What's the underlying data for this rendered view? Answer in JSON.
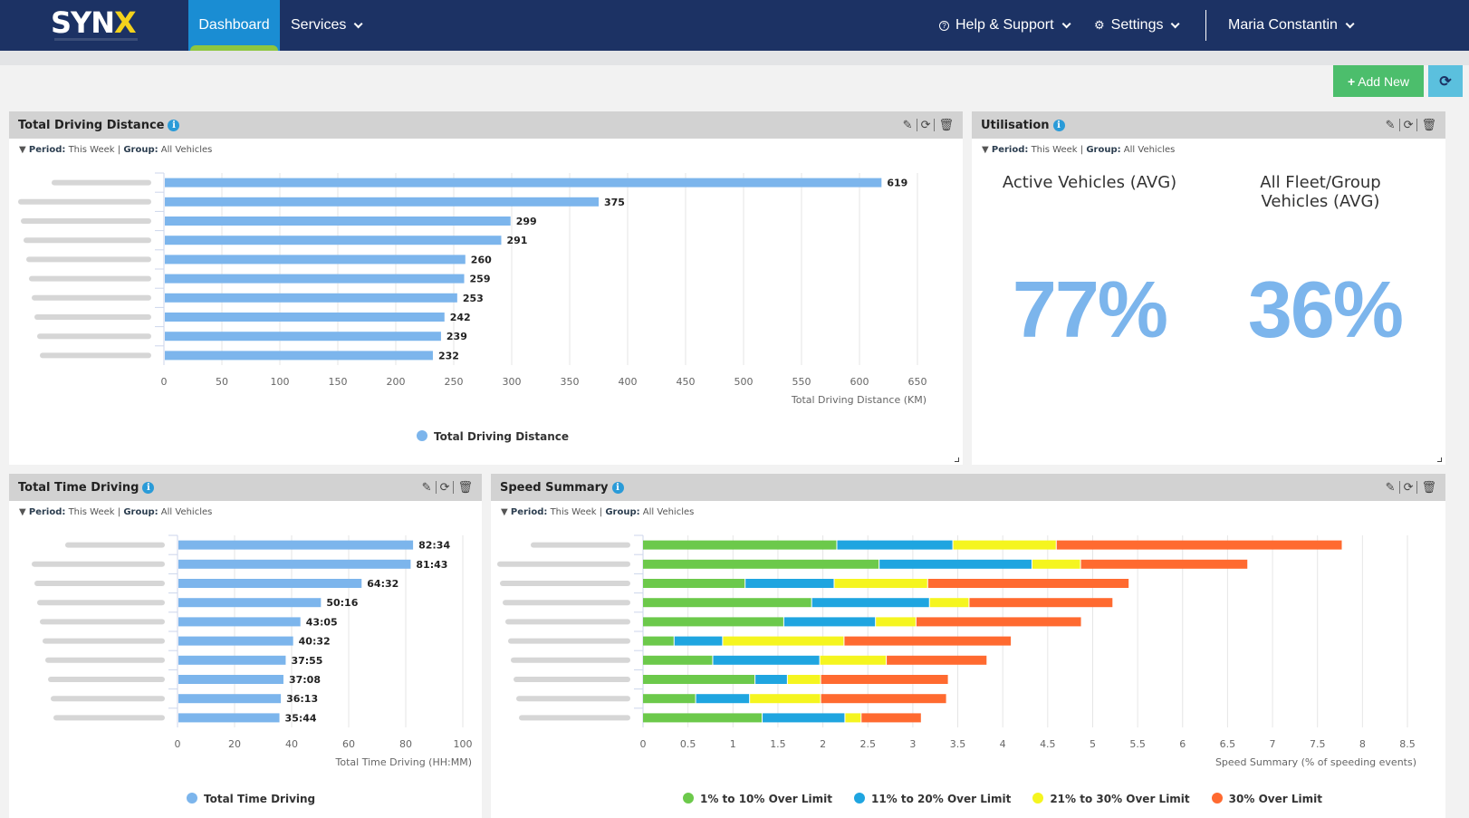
{
  "nav": {
    "logo": {
      "s": "SYN",
      "x": "X"
    },
    "dashboard": "Dashboard",
    "services": "Services",
    "help": "Help & Support",
    "settings": "Settings",
    "user": "Maria Constantin"
  },
  "toolbar": {
    "add_new": "Add New"
  },
  "filter": {
    "period_label": "Period:",
    "period_value": "This Week",
    "group_label": "Group:",
    "group_value": "All Vehicles"
  },
  "panels": {
    "distance": {
      "title": "Total Driving Distance"
    },
    "utilisation": {
      "title": "Utilisation",
      "active_label": "Active Vehicles (AVG)",
      "fleet_label": "All Fleet/Group Vehicles (AVG)",
      "active_value": "77%",
      "fleet_value": "36%"
    },
    "time": {
      "title": "Total Time Driving"
    },
    "speed": {
      "title": "Speed Summary"
    }
  },
  "colors": {
    "bar": "#7cb5ec",
    "green": "#6cc94b",
    "blue": "#1fa5e0",
    "yellow": "#f5f51f",
    "orange": "#ff6a30",
    "nav": "#1c3264",
    "active": "#1a8dd3"
  },
  "chart_data": [
    {
      "id": "distance",
      "type": "bar",
      "orientation": "horizontal",
      "categories": [
        "(blurred)",
        "(blurred)",
        "(blurred)",
        "(blurred)",
        "(blurred)",
        "(blurred)",
        "(blurred)",
        "(blurred)",
        "(blurred)",
        "(blurred)"
      ],
      "values": [
        619,
        375,
        299,
        291,
        260,
        259,
        253,
        242,
        239,
        232
      ],
      "labels": [
        "619",
        "375",
        "299",
        "291",
        "260",
        "259",
        "253",
        "242",
        "239",
        "232"
      ],
      "xlabel": "Total Driving Distance (KM)",
      "xlim": [
        0,
        650
      ],
      "ticks": [
        0,
        50,
        100,
        150,
        200,
        250,
        300,
        350,
        400,
        450,
        500,
        550,
        600,
        650
      ],
      "legend": [
        "Total Driving Distance"
      ],
      "legend_position": "bottom-center",
      "grid": true
    },
    {
      "id": "time",
      "type": "bar",
      "orientation": "horizontal",
      "categories": [
        "(blurred)",
        "(blurred)",
        "(blurred)",
        "(blurred)",
        "(blurred)",
        "(blurred)",
        "(blurred)",
        "(blurred)",
        "(blurred)",
        "(blurred)"
      ],
      "values": [
        82.57,
        81.72,
        64.53,
        50.27,
        43.08,
        40.53,
        37.92,
        37.13,
        36.22,
        35.73
      ],
      "labels": [
        "82:34",
        "81:43",
        "64:32",
        "50:16",
        "43:05",
        "40:32",
        "37:55",
        "37:08",
        "36:13",
        "35:44"
      ],
      "xlabel": "Total Time Driving (HH:MM)",
      "xlim": [
        0,
        100
      ],
      "ticks": [
        0,
        20,
        40,
        60,
        80,
        100
      ],
      "legend": [
        "Total Time Driving"
      ],
      "legend_position": "bottom-center",
      "grid": true
    },
    {
      "id": "speed",
      "type": "bar",
      "orientation": "horizontal",
      "stacked": true,
      "categories": [
        "(blurred)",
        "(blurred)",
        "(blurred)",
        "(blurred)",
        "(blurred)",
        "(blurred)",
        "(blurred)",
        "(blurred)",
        "(blurred)",
        "(blurred)"
      ],
      "series": [
        {
          "name": "1% to 10% Over Limit",
          "color": "#6cc94b",
          "values": [
            2.16,
            2.63,
            1.14,
            1.88,
            1.57,
            0.35,
            0.78,
            1.25,
            0.59,
            1.33
          ]
        },
        {
          "name": "11% to 20% Over Limit",
          "color": "#1fa5e0",
          "values": [
            1.29,
            1.7,
            0.99,
            1.31,
            1.02,
            0.54,
            1.19,
            0.36,
            0.6,
            0.92
          ]
        },
        {
          "name": "21% to 30% Over Limit",
          "color": "#f5f51f",
          "values": [
            1.15,
            0.54,
            1.04,
            0.44,
            0.45,
            1.35,
            0.74,
            0.37,
            0.79,
            0.18
          ]
        },
        {
          "name": "30% Over Limit",
          "color": "#ff6a30",
          "values": [
            3.18,
            1.86,
            2.24,
            1.6,
            1.84,
            1.86,
            1.12,
            1.42,
            1.4,
            0.67
          ]
        }
      ],
      "xlabel": "Speed Summary (% of speeding events)",
      "xlim": [
        0,
        8.5
      ],
      "ticks": [
        "0",
        "0.5",
        "1",
        "1.5",
        "2",
        "2.5",
        "3",
        "3.5",
        "4",
        "4.5",
        "5",
        "5.5",
        "6",
        "6.5",
        "7",
        "7.5",
        "8",
        "8.5"
      ],
      "legend_position": "bottom-center",
      "grid": true
    }
  ]
}
